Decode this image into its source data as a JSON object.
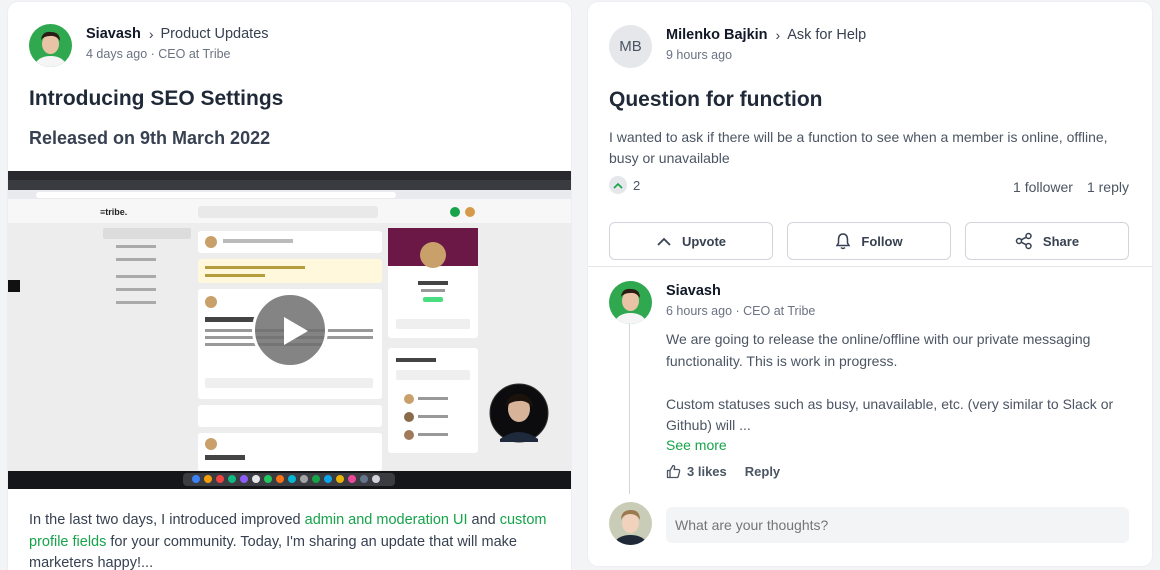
{
  "post": {
    "author": "Siavash",
    "space": "Product Updates",
    "meta": "4 days ago · CEO at Tribe",
    "title": "Introducing SEO Settings",
    "subtitle": "Released on 9th March 2022",
    "body_prefix": "In the last two days, I introduced improved ",
    "body_link1": "admin and moderation UI",
    "body_mid": " and ",
    "body_link2": "custom profile fields",
    "body_suffix": " for your community. Today, I'm sharing an update that will make marketers happy!..."
  },
  "question": {
    "author_initials": "MB",
    "author": "Milenko Bajkin",
    "space": "Ask for Help",
    "meta": "9 hours ago",
    "title": "Question for function",
    "body": "I wanted to ask if there will be a function to see when a member is online, offline, busy or unavailable",
    "upvotes": "2",
    "followers": "1 follower",
    "replies": "1 reply",
    "actions": {
      "upvote": "Upvote",
      "follow": "Follow",
      "share": "Share"
    }
  },
  "reply": {
    "author": "Siavash",
    "meta": "6 hours ago · CEO at Tribe",
    "paragraph1": "We are going to release the online/offline with our private messaging functionality. This is work in progress.",
    "paragraph2": "Custom statuses such as busy, unavailable, etc. (very similar to Slack or Github) will ...",
    "see_more": "See more",
    "likes": "3 likes",
    "reply_label": "Reply"
  },
  "composer": {
    "placeholder": "What are your thoughts?"
  },
  "colors": {
    "accent": "#16a34a",
    "background": "#f3f4f6"
  }
}
